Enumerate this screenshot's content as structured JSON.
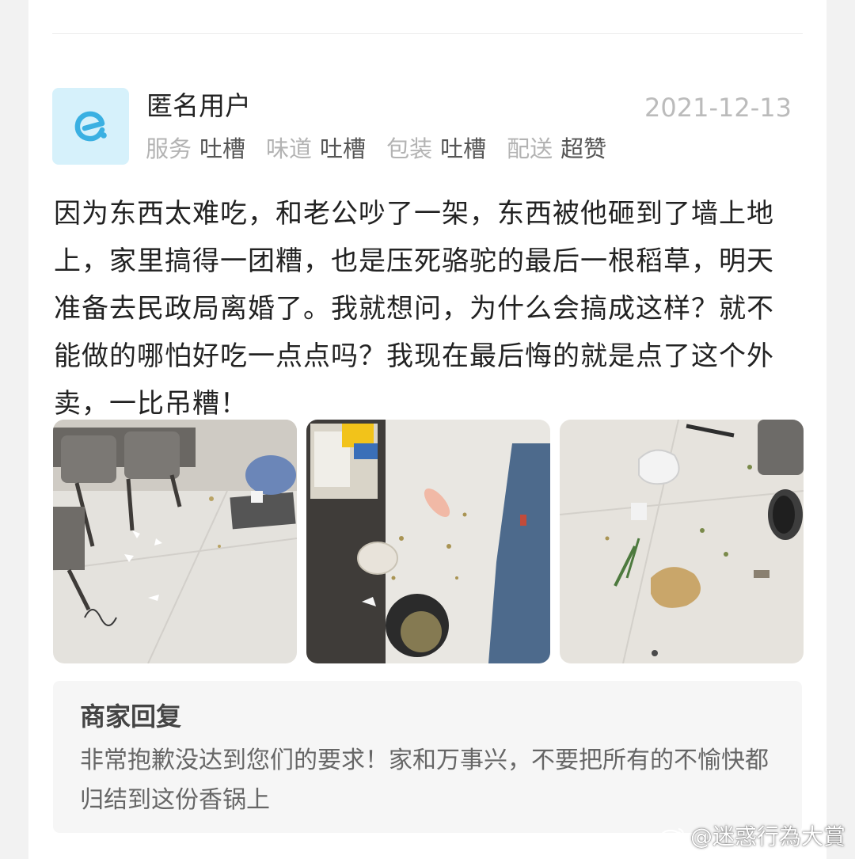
{
  "review": {
    "username": "匿名用户",
    "date": "2021-12-13",
    "avatar_icon": "eleme-logo-icon",
    "ratings": [
      {
        "label": "服务",
        "value": "吐槽"
      },
      {
        "label": "味道",
        "value": "吐槽"
      },
      {
        "label": "包装",
        "value": "吐槽"
      },
      {
        "label": "配送",
        "value": "超赞"
      }
    ],
    "text": "因为东西太难吃，和老公吵了一架，东西被他砸到了墙上地上，家里搞得一团糟，也是压死骆驼的最后一根稻草，明天准备去民政局离婚了。我就想问，为什么会搞成这样？就不能做的哪怕好吃一点点吗？我现在最后悔的就是点了这个外卖，一比吊糟！",
    "photos": [
      "photo-1",
      "photo-2",
      "photo-3"
    ]
  },
  "merchant_reply": {
    "title": "商家回复",
    "text": "非常抱歉没达到您们的要求！家和万事兴，不要把所有的不愉快都归结到这份香锅上"
  },
  "watermark": {
    "text": "@迷惑行為大賞",
    "icon": "weibo-icon"
  },
  "colors": {
    "brand": "#3ab0e2",
    "avatar_bg": "#d6f1fb"
  }
}
